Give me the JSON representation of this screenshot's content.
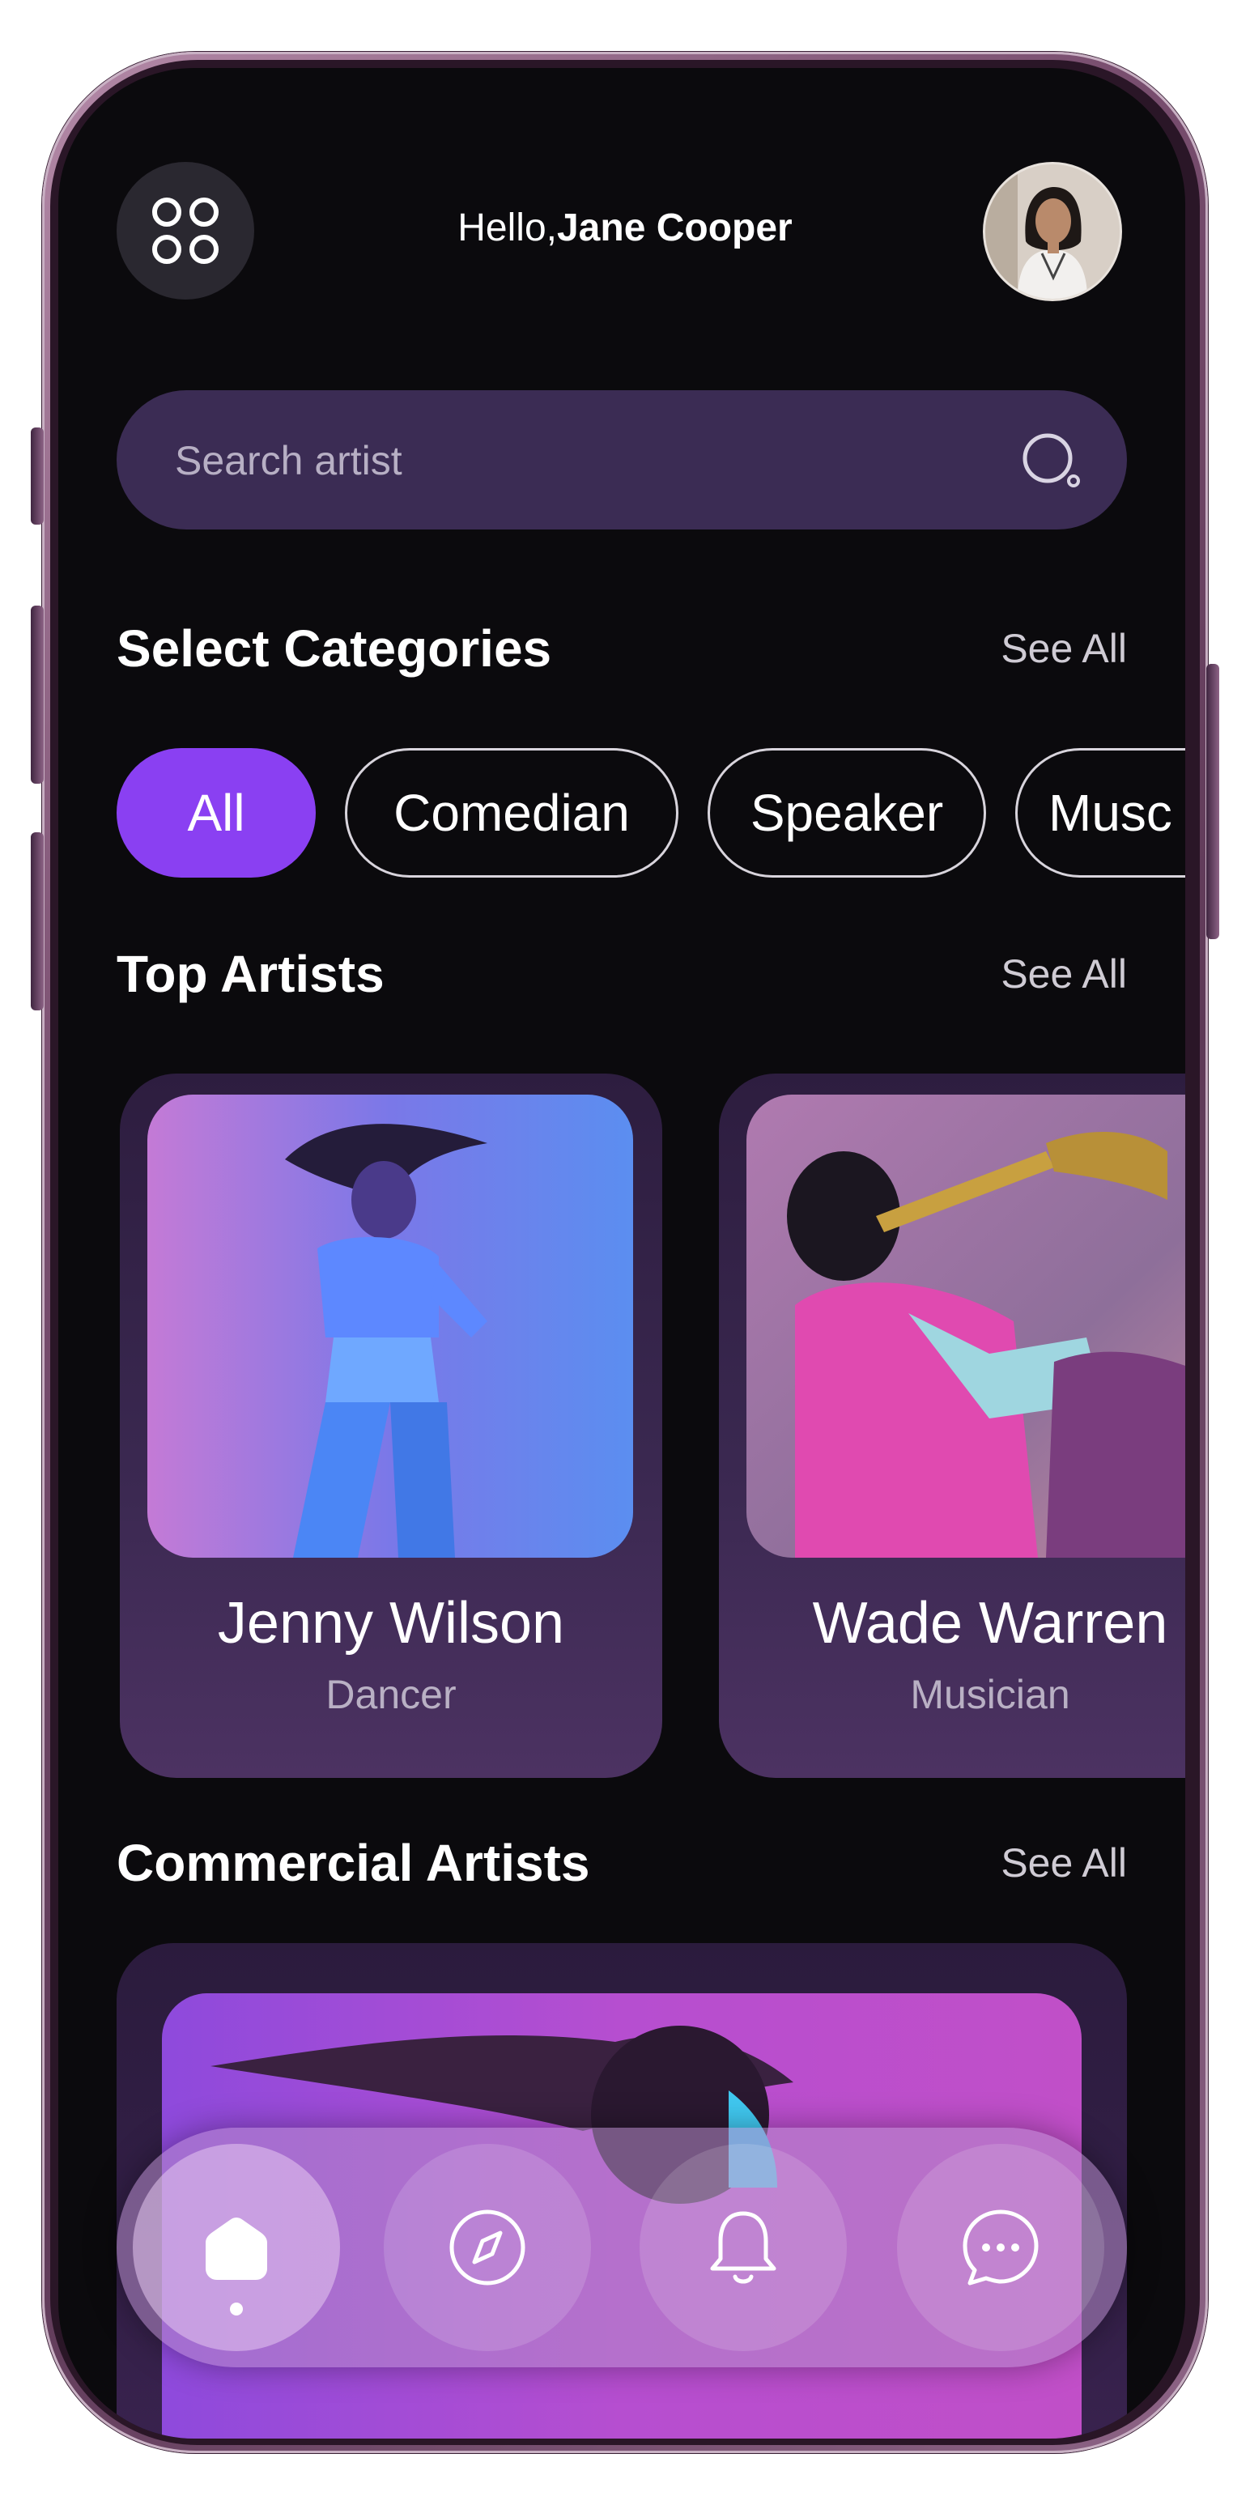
{
  "header": {
    "greeting_prefix": "Hello,",
    "user_name": "Jane Cooper"
  },
  "search": {
    "placeholder": "Search artist"
  },
  "categories": {
    "title": "Select Categories",
    "see_all": "See All",
    "chips": [
      "All",
      "Comedian",
      "Speaker",
      "Musc"
    ],
    "active_chip": "All"
  },
  "top_artists": {
    "title": "Top Artists",
    "see_all": "See All",
    "items": [
      {
        "name": "Jenny Wilson",
        "role": "Dancer"
      },
      {
        "name": "Wade Warren",
        "role": "Musician"
      }
    ]
  },
  "commercial_artists": {
    "title": "Commercial Artists",
    "see_all": "See All"
  },
  "bottom_nav": {
    "items": [
      "home-icon",
      "compass-icon",
      "bell-icon",
      "chat-icon"
    ],
    "active": "home-icon"
  },
  "colors": {
    "accent": "#8a40f2",
    "background": "#0b0a0d",
    "search_bg": "#3b2c54"
  }
}
